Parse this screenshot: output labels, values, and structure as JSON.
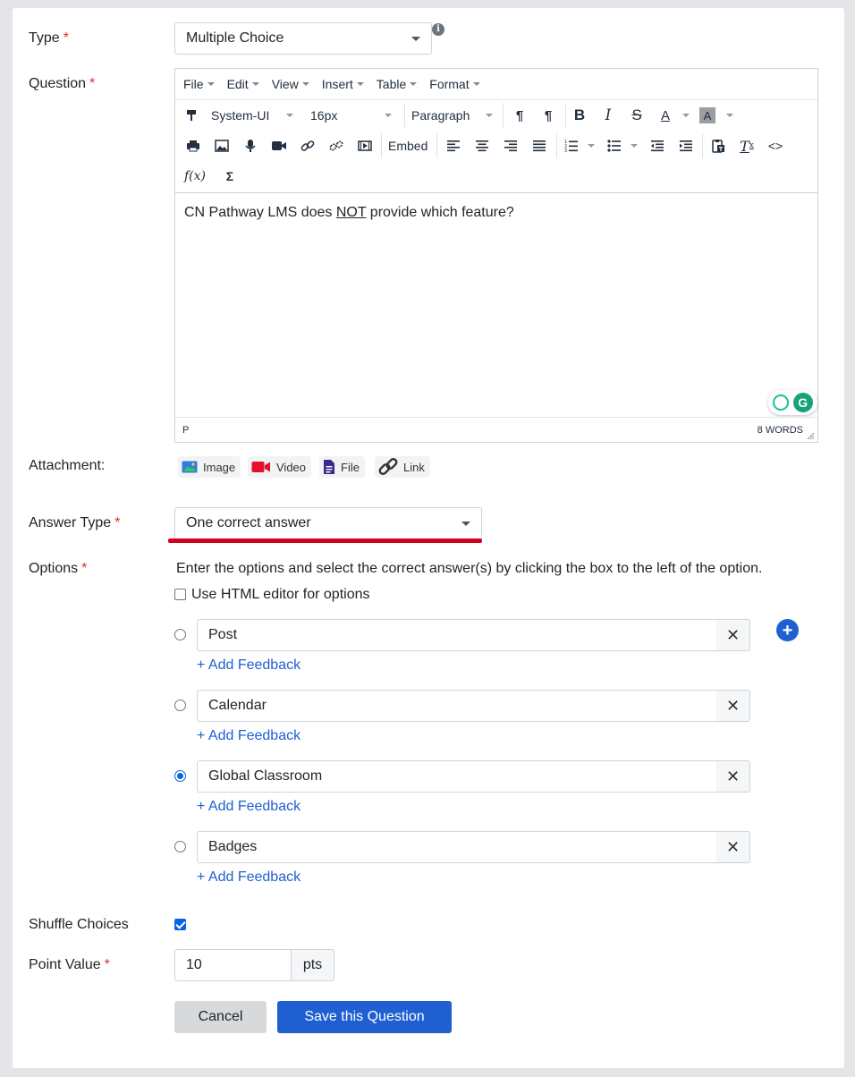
{
  "form": {
    "type": {
      "label": "Type",
      "required_mark": "*",
      "value": "Multiple Choice"
    },
    "question": {
      "label": "Question",
      "required_mark": "*"
    },
    "attachment": {
      "label": "Attachment:"
    },
    "answer_type": {
      "label": "Answer Type",
      "required_mark": "*",
      "value": "One correct answer"
    },
    "options_section": {
      "label": "Options",
      "required_mark": "*",
      "instructions": "Enter the options and select the correct answer(s) by clicking the box to the left of the option.",
      "html_editor_label": "Use HTML editor for options",
      "html_editor_checked": false
    },
    "shuffle": {
      "label": "Shuffle Choices",
      "checked": true
    },
    "point_value": {
      "label": "Point Value",
      "required_mark": "*",
      "value": "10",
      "unit": "pts"
    }
  },
  "editor": {
    "menus": [
      "File",
      "Edit",
      "View",
      "Insert",
      "Table",
      "Format"
    ],
    "font_family": "System-UI",
    "font_size": "16px",
    "block_format": "Paragraph",
    "embed_label": "Embed",
    "formula_label": "f(x)",
    "sigma_label": "Σ",
    "content": {
      "before": "CN Pathway LMS does ",
      "underlined": "NOT",
      "after": " provide which feature?"
    },
    "status_path": "P",
    "word_count": "8 WORDS"
  },
  "attachments": [
    {
      "label": "Image",
      "icon": "image-icon"
    },
    {
      "label": "Video",
      "icon": "video-icon"
    },
    {
      "label": "File",
      "icon": "file-icon"
    },
    {
      "label": "Link",
      "icon": "link-icon"
    }
  ],
  "options": [
    {
      "text": "Post",
      "selected": false,
      "feedback_link": "+ Add Feedback"
    },
    {
      "text": "Calendar",
      "selected": false,
      "feedback_link": "+ Add Feedback"
    },
    {
      "text": "Global Classroom",
      "selected": true,
      "feedback_link": "+ Add Feedback"
    },
    {
      "text": "Badges",
      "selected": false,
      "feedback_link": "+ Add Feedback"
    }
  ],
  "buttons": {
    "cancel": "Cancel",
    "save": "Save this Question",
    "remove_symbol": "✕",
    "add_symbol": "+"
  },
  "colors": {
    "primary": "#1f5fd1",
    "required": "#d9312a",
    "highlight_underline": "#d0021b"
  }
}
